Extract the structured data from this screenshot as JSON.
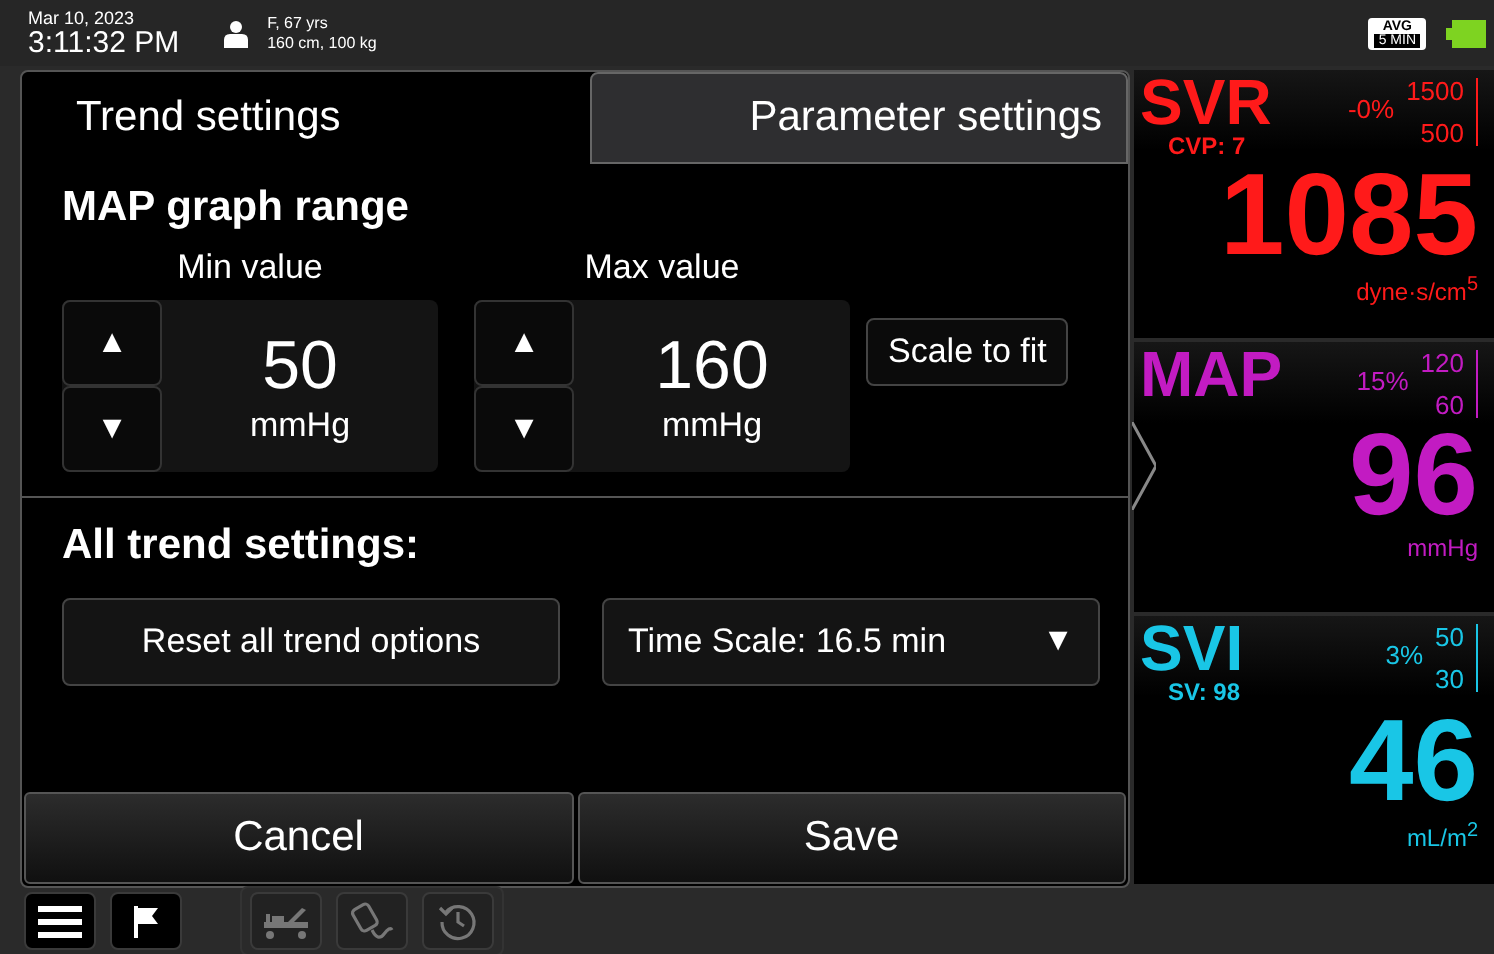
{
  "status_bar": {
    "date": "Mar 10, 2023",
    "time": "3:11:32 PM",
    "patient_line_1": "F, 67 yrs",
    "patient_line_2": "160 cm, 100 kg",
    "avg_label": "AVG",
    "avg_period": "5 MIN"
  },
  "tabs": [
    {
      "label": "Trend settings",
      "selected": true
    },
    {
      "label": "Parameter settings",
      "selected": false
    }
  ],
  "graph_range": {
    "title": "MAP graph range",
    "steppers": [
      {
        "label": "Min value",
        "up": "▲",
        "down": "▼",
        "value": "50",
        "unit": "mmHg"
      },
      {
        "label": "Max value",
        "up": "▲",
        "down": "▼",
        "value": "160",
        "unit": "mmHg"
      }
    ],
    "scale_button": "Scale to fit"
  },
  "all_trend": {
    "title": "All trend settings:",
    "reset_button": "Reset all trend options",
    "time_scale": {
      "value": "Time Scale: 16.5 min",
      "caret": "▼"
    }
  },
  "footer_buttons": [
    "Cancel",
    "Save"
  ],
  "parameters": [
    {
      "name": "SVR",
      "color": "#ff1a1a",
      "sub": "CVP: 7",
      "change": "-0%",
      "high": "1500",
      "low": "500",
      "value": "1085",
      "unit": "dyne·s/cm$^{5}$",
      "selected": false
    },
    {
      "name": "MAP",
      "color": "#c21bc2",
      "change": "15%",
      "high": "120",
      "low": "60",
      "value": "96",
      "unit": "mmHg",
      "selected": true
    },
    {
      "name": "SVI",
      "color": "#19c6e6",
      "sub": "SV: 98",
      "change": "3%",
      "high": "50",
      "low": "30",
      "value": "46",
      "unit": "mL/m$^{2}$",
      "selected": false
    }
  ]
}
